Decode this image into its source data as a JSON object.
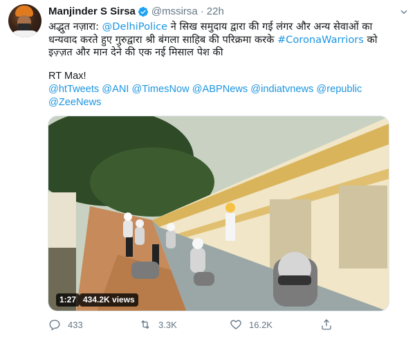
{
  "author": {
    "name": "Manjinder S Sirsa",
    "handle": "@mssirsa",
    "separator": "·",
    "time": "22h"
  },
  "tweet": {
    "line1_part1": "अद्भुत नज़ारा: ",
    "line1_link": "@DelhiPolice",
    "line1_part2": " ने सिख समुदाय द्वारा की गई लंगर और अन्य सेवाओं का",
    "line2_part1": "धन्यवाद करते हुए गुरुद्वारा श्री बंगला साहिब की परिक्रमा करके ",
    "line2_hashtag": "#CoronaWarriors",
    "line2_part2": " को",
    "line3": "इज़्ज़त और मान देने की एक नई मिसाल पेश की",
    "rt_line": "RT Max!",
    "mentions_line1": "@htTweets @ANI @TimesNow @ABPNews @indiatvnews @republic",
    "mentions_line2": "@ZeeNews"
  },
  "video": {
    "duration": "1:27",
    "views": "434.2K views"
  },
  "actions": {
    "reply_count": "433",
    "retweet_count": "3.3K",
    "like_count": "16.2K"
  },
  "icons": {
    "verified": "verified-badge-icon",
    "menu": "chevron-down-icon",
    "reply": "reply-icon",
    "retweet": "retweet-icon",
    "like": "heart-icon",
    "share": "share-icon"
  },
  "colors": {
    "link": "#1b95e0",
    "muted": "#657786",
    "verified": "#1da1f2"
  }
}
